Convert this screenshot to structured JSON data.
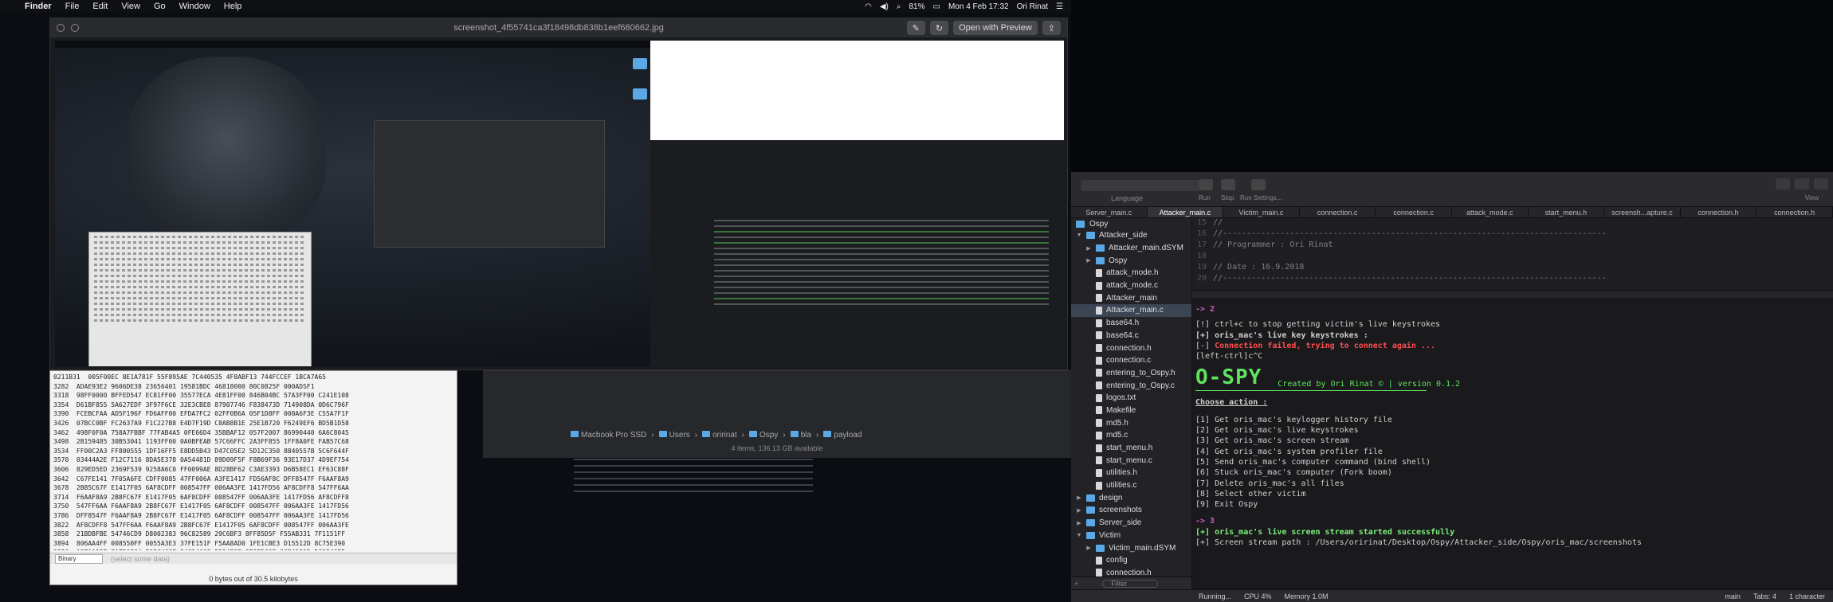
{
  "menubar": {
    "app": "Finder",
    "items": [
      "File",
      "Edit",
      "View",
      "Go",
      "Window",
      "Help"
    ],
    "battery": "81%",
    "datetime": "Mon 4 Feb 17:32",
    "user": "Ori Rinat"
  },
  "quicklook": {
    "title": "screenshot_4f55741ca3f18498db838b1eef680662.jpg",
    "open_button": "Open with Preview"
  },
  "hex_editor": {
    "rows": [
      "0211B31  005F00EC 8E1A781F 55F895AE 7C440535 4F8ABF13 744FCCEF 1BCA7A65",
      "3282  ADAE93E2 9606DE38 23656401 19581BDC 46818000 80C0825F 000ADSF1",
      "3318  98FF0000 BFFED547 EC81FF00 35577ECA 4E81FF00 846B04BC 57A3FF00 C241E108",
      "3354  D61BF855 5A627EDF 3F97F6CE 32E3CBE8 87907746 F838473D 714908DA 0D6C796F",
      "3390  FCEBCFAA AD5F196F FD6AFF00 EFDA7FC2 02FF0B6A 05F1D8FF 008A6F3E C55A7F1F",
      "3426  07BCC0BF FC2637A9 F1C227B8 E4D7F19D C8AB8B1E 25E1B720 F6249EF6 BD5B1D58",
      "3462  498F0F0A 758A7FBBF 77FAB4A5 0FE66D4 35BBAF12 057F2007 86990440 6A6C8045",
      "3498  2B159485 30B53041 1193FF00 0A0BFEAB 57C66FFC 2A3FF855 1FF8A0FE FAB57C68",
      "3534  FF00C2A3 FF800555 1DF16FF5 E8DD5B43 D47C05E2 5D12C350 8840557B 5C6F644F",
      "3570  03444A2E F12C7116 8DA5E378 0A54481D 89D09F5F F8B69F36 93E17D37 4D9EF754",
      "3606  829ED5ED 2369F539 9258A6C0 FF0099AE 8D28BF62 C3AE3393 D6B58EC1 EF63C88F",
      "3642  C67FE141 7F05A6FE CDFF0085 47FF006A A3FE1417 FD56AF8C DFF8547F F6AAF8A9",
      "3678  2B85C67F E1417F05 6AF8CDFF 008547FF 006AA3FE 1417FD56 AF8CDFF8 547FF6AA",
      "3714  F6AAF8A9 2B8FC67F E1417F05 6AF8CDFF 008547FF 006AA3FE 1417FD56 AF8CDFF8",
      "3750  547FF6AA F6AAF8A9 2B8FC67F E1417F05 6AF8CDFF 008547FF 006AA3FE 1417FD56",
      "3786  DFF8547F F6AAF8A9 2B8FC67F E1417F05 6AF8CDFF 008547FF 006AA3FE 1417FD56",
      "3822  AF8CDFF8 547FF6AA F6AAF8A9 2B8FC67F E1417F05 6AF8CDFF 008547FF 006AA3FE",
      "3858  21BDBFBE 54746CD9 D8002383 96C82589 29C6BF3 8FF85D5F F55AB331 7F1151FF",
      "3894  806AA4FF 008550FF 0055A3E3 37FE151F F5AA8AD0 1FE1CBE3 D15512D 8C75E390",
      "3930  A37AA15E EA7D6804 F68C460F 94C14609 F29470E 0B3EDC6F 6CF4131D D05846BD"
    ],
    "select_value": "Binary",
    "select_placeholder": "(select some data)",
    "status": "0 bytes out of 30.5 kilobytes"
  },
  "finder_behind": {
    "path": [
      "Macbook Pro SSD",
      "Users",
      "oririnat",
      "Ospy",
      "bla",
      "payload"
    ],
    "items_count": "4 items, 136.13 GB available"
  },
  "xcode": {
    "language_label": "Language",
    "toolbar_labels": {
      "run": "Run",
      "stop": "Stop",
      "run_settings": "Run Settings...",
      "view": "View"
    },
    "tabs": [
      "Server_main.c",
      "Attacker_main.c",
      "Victim_main.c",
      "connection.c",
      "connection.c",
      "attack_mode.c",
      "start_menu.h",
      "screensh...apture.c",
      "connection.h",
      "connection.h"
    ],
    "navigator_header": "Ospy",
    "navigator": [
      {
        "label": "Attacker_side",
        "type": "folder",
        "depth": 0,
        "open": true
      },
      {
        "label": "Attacker_main.dSYM",
        "type": "folder",
        "depth": 1,
        "open": false
      },
      {
        "label": "Ospy",
        "type": "folder",
        "depth": 1,
        "open": false
      },
      {
        "label": "attack_mode.h",
        "type": "file",
        "depth": 1
      },
      {
        "label": "attack_mode.c",
        "type": "file",
        "depth": 1
      },
      {
        "label": "Attacker_main",
        "type": "file",
        "depth": 1
      },
      {
        "label": "Attacker_main.c",
        "type": "file",
        "depth": 1,
        "selected": true
      },
      {
        "label": "base64.h",
        "type": "file",
        "depth": 1
      },
      {
        "label": "base64.c",
        "type": "file",
        "depth": 1
      },
      {
        "label": "connection.h",
        "type": "file",
        "depth": 1
      },
      {
        "label": "connection.c",
        "type": "file",
        "depth": 1
      },
      {
        "label": "entering_to_Ospy.h",
        "type": "file",
        "depth": 1
      },
      {
        "label": "entering_to_Ospy.c",
        "type": "file",
        "depth": 1
      },
      {
        "label": "logos.txt",
        "type": "file",
        "depth": 1
      },
      {
        "label": "Makefile",
        "type": "file",
        "depth": 1
      },
      {
        "label": "md5.h",
        "type": "file",
        "depth": 1
      },
      {
        "label": "md5.c",
        "type": "file",
        "depth": 1
      },
      {
        "label": "start_menu.h",
        "type": "file",
        "depth": 1
      },
      {
        "label": "start_menu.c",
        "type": "file",
        "depth": 1
      },
      {
        "label": "utilities.h",
        "type": "file",
        "depth": 1
      },
      {
        "label": "utilities.c",
        "type": "file",
        "depth": 1
      },
      {
        "label": "design",
        "type": "folder",
        "depth": 0,
        "open": false
      },
      {
        "label": "screenshots",
        "type": "folder",
        "depth": 0,
        "open": false
      },
      {
        "label": "Server_side",
        "type": "folder",
        "depth": 0,
        "open": false
      },
      {
        "label": "Victim",
        "type": "folder",
        "depth": 0,
        "open": true
      },
      {
        "label": "Victim_main.dSYM",
        "type": "folder",
        "depth": 1,
        "open": false
      },
      {
        "label": "config",
        "type": "file",
        "depth": 1
      },
      {
        "label": "connection.h",
        "type": "file",
        "depth": 1
      },
      {
        "label": "connection.c",
        "type": "file",
        "depth": 1
      }
    ],
    "filter_placeholder": "Filter",
    "editor": [
      {
        "ln": "15",
        "text": "//"
      },
      {
        "ln": "16",
        "text": "//--------------------------------------------------------------------------------"
      },
      {
        "ln": "17",
        "text": "// Programmer : Ori Rinat"
      },
      {
        "ln": "18",
        "text": ""
      },
      {
        "ln": "19",
        "text": "// Date : 16.9.2018"
      },
      {
        "ln": "20",
        "text": "//--------------------------------------------------------------------------------"
      }
    ],
    "console": {
      "prompt1": "-> 2",
      "line_stop": "[!] ctrl+c to stop getting victim's live keystrokes",
      "line_live": "[+] oris_mac's live key keystrokes :",
      "line_fail_prefix": "[-] ",
      "line_fail": "Connection failed, trying to connect again ...",
      "line_ctrl": "[left-ctrl]c^C",
      "logo_art": "O-SPY",
      "logo_credit": "Created by Ori Rinat © | version 0.1.2",
      "choose": "Choose action :",
      "options": [
        "[1] Get oris_mac's keylogger history file",
        "[2] Get oris_mac's live keystrokes",
        "[3] Get oris_mac's screen stream",
        "[4] Get oris_mac's system profiler file",
        "[5] Send oris_mac's computer command (bind shell)",
        "[6] Stuck oris_mac's computer (Fork boom)",
        "[7] Delete oris_mac's all files",
        "[8] Select other victim",
        "[9] Exit Ospy"
      ],
      "prompt2": "-> 3",
      "line_stream": "[+] oris_mac's live screen stream started successfully",
      "line_path": "[+] Screen stream path : /Users/oririnat/Desktop/Ospy/Attacker_side/Ospy/oris_mac/screenshots"
    },
    "status": {
      "running": "Running...",
      "cpu": "CPU 4%",
      "memory": "Memory 1.0M",
      "branch": "main",
      "tabs": "Tabs: 4",
      "chars": "1 character"
    }
  },
  "colors": {
    "accent_green": "#5fe35f",
    "error_red": "#ff4d4d",
    "prompt_purple": "#d05bd0"
  }
}
